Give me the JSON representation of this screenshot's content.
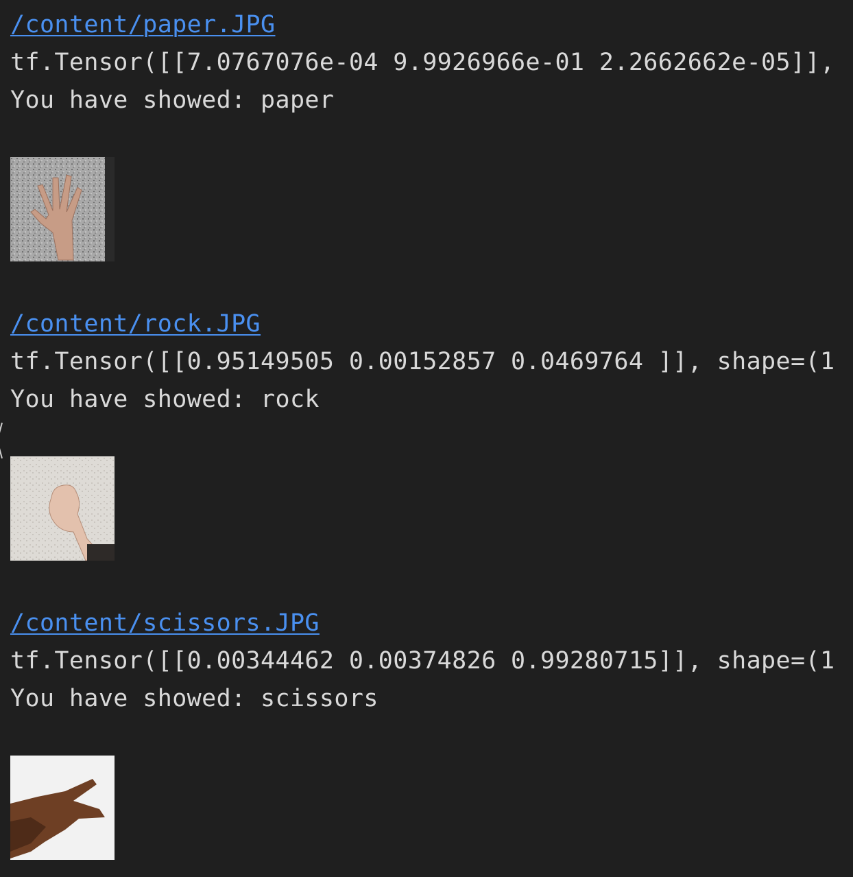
{
  "outputs": [
    {
      "path": "/content/paper.JPG",
      "tensor": "tf.Tensor([[7.0767076e-04 9.9926966e-01 2.2662662e-05]], ",
      "result": "You have showed: paper",
      "image_icon": "paper-hand-image"
    },
    {
      "path": "/content/rock.JPG",
      "tensor": "tf.Tensor([[0.95149505 0.00152857 0.0469764 ]], shape=(1",
      "result": "You have showed: rock",
      "image_icon": "rock-hand-image"
    },
    {
      "path": "/content/scissors.JPG",
      "tensor": "tf.Tensor([[0.00344462 0.00374826 0.99280715]], shape=(1",
      "result": "You have showed: scissors",
      "image_icon": "scissors-hand-image"
    }
  ],
  "colors": {
    "background": "#1f1f1f",
    "text": "#d9d9d9",
    "link": "#4a90f0"
  }
}
